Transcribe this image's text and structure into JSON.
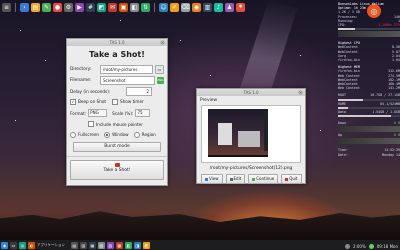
{
  "capture_window": {
    "window_title": "TAS 1.0",
    "heading": "Take a Shot!",
    "directory_label": "Directory:",
    "directory_value": "/root/my-pictures",
    "filename_label": "Filename:",
    "filename_value": "Screenshot",
    "format_badge": "PNG",
    "delay_label": "Delay (in seconds):",
    "delay_value": "2",
    "beep_label": "Beep on Shot",
    "show_timer_label": "Show timer",
    "format_label": "Format:",
    "format_value": "PNG",
    "scale_label": "Scale (%):",
    "scale_value": "75",
    "mouse_pointer_label": "Include mouse pointer",
    "fullscreen_label": "Fullscreen",
    "window_label": "Window",
    "region_label": "Region",
    "burst_label": "Burst mode",
    "shoot_label": "Take a Shot!"
  },
  "preview_window": {
    "window_title": "TAS 1.0",
    "label": "Preview",
    "file_path": "/root/my-pictures/Screenshot(12).png",
    "view_label": "View",
    "edit_label": "Edit",
    "continue_label": "Continue",
    "quit_label": "Quit"
  },
  "conky": {
    "header_lines": [
      "BunsenLabs Linux Helium",
      "Uptime: 1h 23m",
      "1.2K / 3 GB"
    ],
    "stats": [
      {
        "k": "Processes:",
        "v": "140"
      },
      {
        "k": "Running:",
        "v": "1"
      },
      {
        "k": "CPU:",
        "v": "1.200Hz 27%"
      }
    ],
    "mem_header": "Highest CPU",
    "cpu_procs": [
      {
        "k": "WebContent",
        "v": "8.56"
      },
      {
        "k": "WebContent",
        "v": "5.87"
      },
      {
        "k": "Xorg",
        "v": "2.04"
      },
      {
        "k": "firefox-bin",
        "v": "1.04"
      }
    ],
    "highest_mem": "Highest MEM",
    "mem_procs": [
      {
        "k": "firefox-bin",
        "v": "312.6M"
      },
      {
        "k": "Web Content",
        "v": "274.5M"
      },
      {
        "k": "WebContent",
        "v": "182.1M"
      },
      {
        "k": "WebContent",
        "v": "160.4M"
      },
      {
        "k": "Web Content",
        "v": "141.2M"
      }
    ],
    "fs_rows": [
      {
        "k": "ROOT",
        "v": "10.7GB / 27.1GB"
      },
      {
        "k": "HOME",
        "v": "85.1/524MB"
      },
      {
        "k": "Data",
        "v": "1.54GB / 1.8GB"
      }
    ],
    "net_rows": [
      {
        "k": "Down",
        "v": "0 B"
      },
      {
        "k": "Up",
        "v": "0 B"
      }
    ],
    "clock_rows": [
      {
        "k": "Time:",
        "v": "14:52:39"
      },
      {
        "k": "Date:",
        "v": "Monday 14"
      }
    ]
  },
  "taskbar": {
    "app_label": "アプリケーション",
    "tray_percent": "2:00%",
    "tray_time": "09:18 Mon"
  },
  "colors": {
    "accent_ubuntu": "#e95420",
    "quit_red": "#c0392b",
    "window_bg": "#ececec"
  }
}
